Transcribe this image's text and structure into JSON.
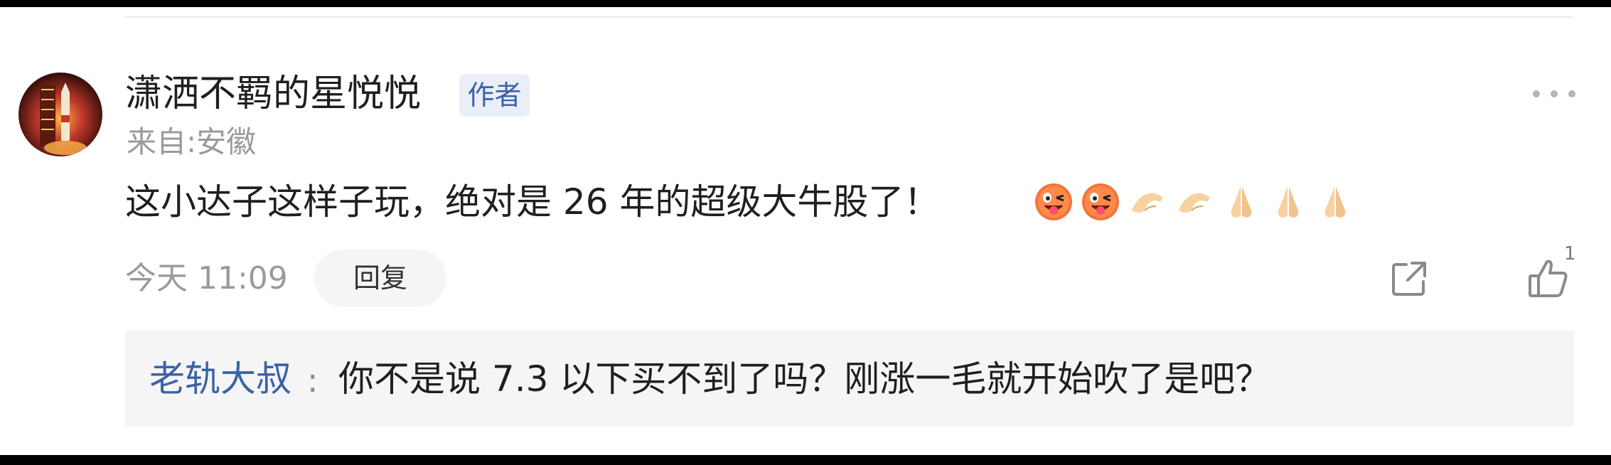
{
  "comment": {
    "username": "潇洒不羁的星悦悦",
    "author_badge": "作者",
    "location": "来自:安徽",
    "text": "这小达子这样子玩，绝对是 26 年的超级大牛股了！",
    "emojis": [
      "winking-tongue-face-emoji",
      "winking-tongue-face-emoji",
      "pinching-hand-emoji",
      "pinching-hand-emoji",
      "praying-hands-emoji",
      "praying-hands-emoji",
      "praying-hands-emoji"
    ],
    "time": "今天 11:09",
    "reply_label": "回复",
    "like_count": "1"
  },
  "sub_reply": {
    "name": "老轨大叔",
    "separator": ":",
    "text": "你不是说 7.3 以下买不到了吗？刚涨一毛就开始吹了是吧？"
  },
  "colors": {
    "link_blue": "#3a63a6",
    "badge_bg": "#e9eef7",
    "muted_text": "#9a9a9a",
    "sub_reply_bg": "#f5f5f5"
  }
}
